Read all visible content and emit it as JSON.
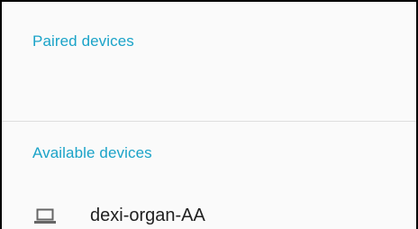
{
  "paired_section": {
    "header": "Paired devices"
  },
  "available_section": {
    "header": "Available devices",
    "devices": [
      {
        "name": "dexi-organ-AA",
        "icon": "laptop-icon"
      }
    ]
  },
  "colors": {
    "accent": "#1aa3c8",
    "text_primary": "#212121",
    "divider": "#dedede",
    "background": "#fafafa"
  }
}
